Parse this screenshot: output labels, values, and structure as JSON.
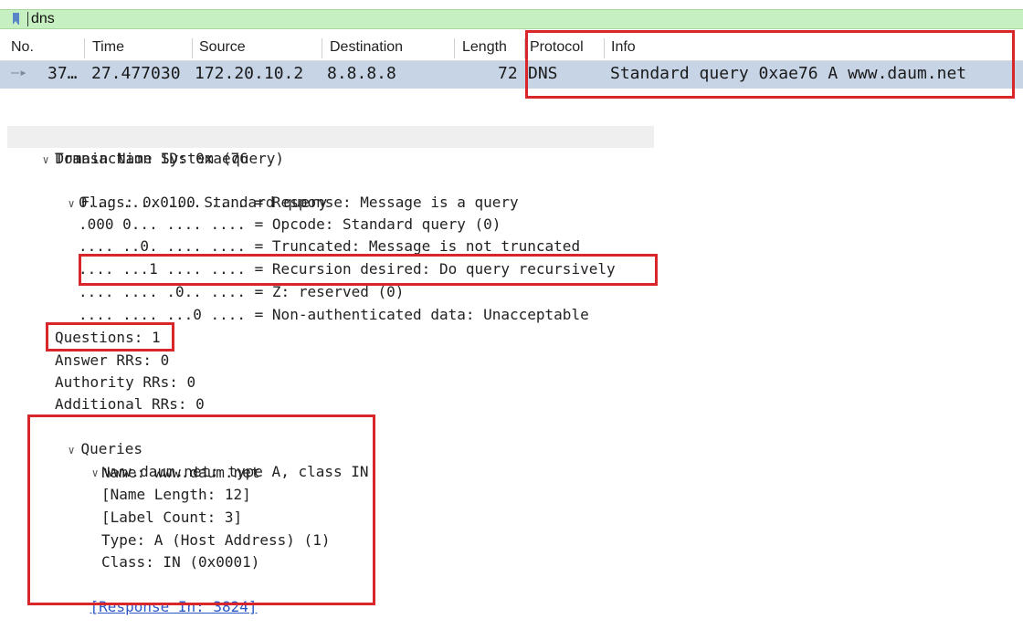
{
  "filter": {
    "text": "dns"
  },
  "columns": [
    "No.",
    "Time",
    "Source",
    "Destination",
    "Length",
    "Protocol",
    "Info"
  ],
  "packet": {
    "no": "37…",
    "time": "27.477030",
    "source": "172.20.10.2",
    "destination": "8.8.8.8",
    "length": "72",
    "protocol": "DNS",
    "info": "Standard query 0xae76 A www.daum.net"
  },
  "tree": {
    "dns": "Domain Name System (query)",
    "transaction_id": "Transaction ID: 0xae76",
    "flags": "Flags: 0x0100 Standard query",
    "flag_response": "0... .... .... .... = Response: Message is a query",
    "flag_opcode": ".000 0... .... .... = Opcode: Standard query (0)",
    "flag_truncated": ".... ..0. .... .... = Truncated: Message is not truncated",
    "flag_recursion": ".... ...1 .... .... = Recursion desired: Do query recursively",
    "flag_z": ".... .... .0.. .... = Z: reserved (0)",
    "flag_nonauth": ".... .... ...0 .... = Non-authenticated data: Unacceptable",
    "questions": "Questions: 1",
    "answer_rrs": "Answer RRs: 0",
    "authority_rrs": "Authority RRs: 0",
    "additional_rrs": "Additional RRs: 0",
    "queries": "Queries",
    "query_entry": "www.daum.net: type A, class IN",
    "name": "Name: www.daum.net",
    "name_length": "[Name Length: 12]",
    "label_count": "[Label Count: 3]",
    "type": "Type: A (Host Address) (1)",
    "class": "Class: IN (0x0001)",
    "response_in": "[Response In: 3824]"
  },
  "highlight_color": "#d9262a"
}
